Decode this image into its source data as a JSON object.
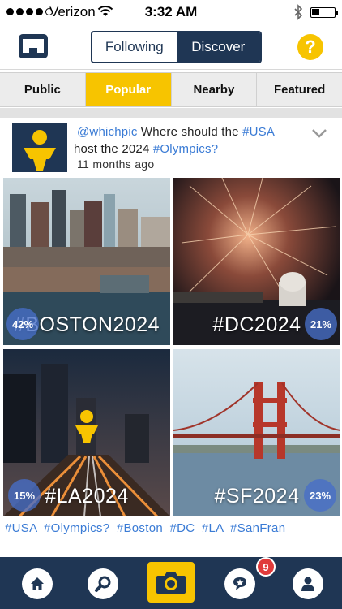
{
  "status_bar": {
    "carrier": "Verizon",
    "time": "3:32 AM",
    "signal_bars_filled": 4,
    "signal_bars_total": 5
  },
  "top_nav": {
    "segments": [
      "Following",
      "Discover"
    ],
    "selected_segment": "Discover",
    "help_label": "?"
  },
  "filter_tabs": {
    "items": [
      "Public",
      "Popular",
      "Nearby",
      "Featured"
    ],
    "selected": "Popular"
  },
  "post": {
    "username": "@whichpic",
    "text_1": " Where should the ",
    "tag_1": "#USA",
    "text_2": " host the 2024 ",
    "tag_2": "#Olympics?",
    "timestamp": "11 months ago",
    "photos": [
      {
        "label": "#BOSTON2024",
        "percent": "42%"
      },
      {
        "label": "#DC2024",
        "percent": "21%"
      },
      {
        "label": "#LA2024",
        "percent": "15%"
      },
      {
        "label": "#SF2024",
        "percent": "23%"
      }
    ],
    "hashtags": "#USA  #Olympics?  #Boston  #DC  #LA  #SanFran"
  },
  "bottom_bar": {
    "notification_count": "9",
    "icons": [
      "home-icon",
      "search-icon",
      "camera-icon",
      "notifications-icon",
      "profile-icon"
    ]
  },
  "colors": {
    "navy": "#1f3654",
    "accent_yellow": "#f7c400",
    "link_blue": "#3a7bd5",
    "badge_red": "#e03b3b"
  }
}
